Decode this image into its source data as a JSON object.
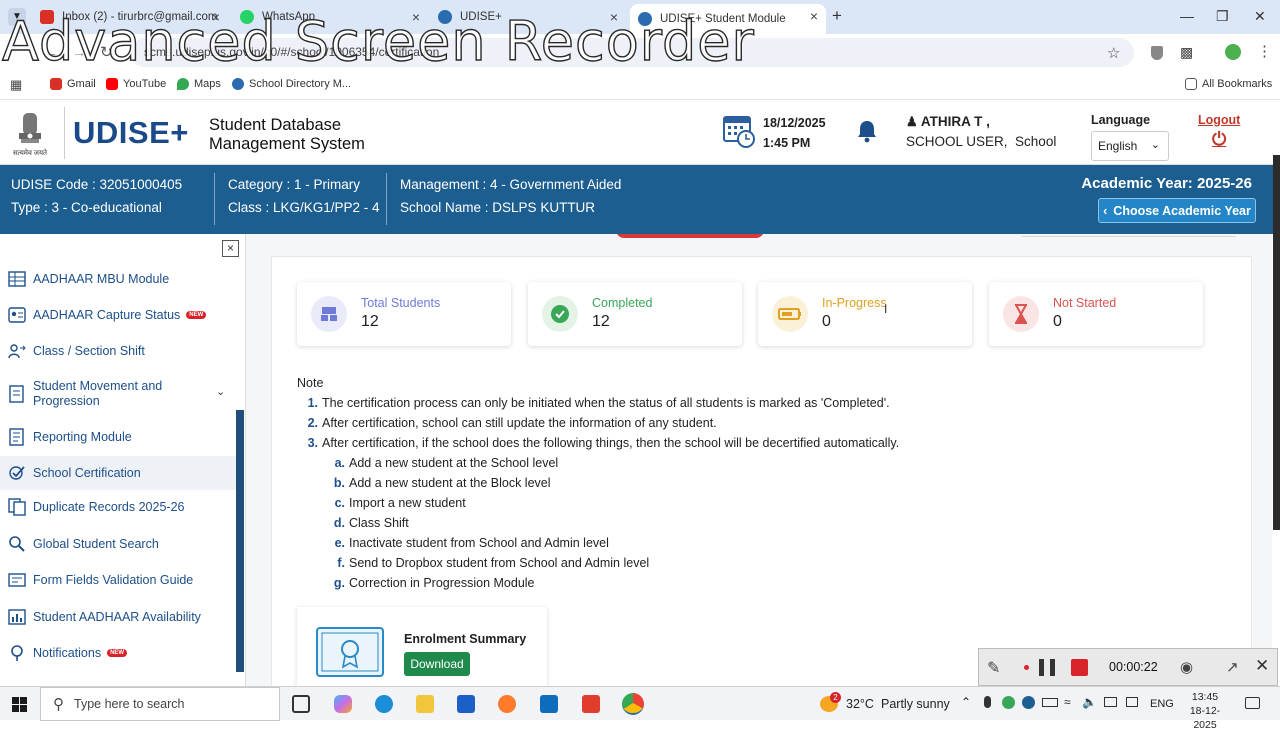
{
  "browser": {
    "tabs": [
      {
        "title": "Inbox (2) - tirurbrc@gmail.com",
        "color": "#d93025"
      },
      {
        "title": "WhatsApp",
        "color": "#25d366"
      },
      {
        "title": "UDISE+",
        "color": "#2b6cb0"
      },
      {
        "title": "UDISE+ Student Module",
        "color": "#2b6cb0"
      }
    ],
    "url": "scms.udiseplus.gov.in/g0/#/school/1006354/certification",
    "bookmarks": [
      "Gmail",
      "YouTube",
      "Maps",
      "School Directory M..."
    ],
    "all_bookmarks": "All Bookmarks",
    "watermark": "Advanced Screen Recorder"
  },
  "header": {
    "logo": "UDISE+",
    "app_name_line1": "Student Database",
    "app_name_line2": "Management System",
    "emblem_motto": "सत्यमेव जयते",
    "date": "18/12/2025",
    "time": "1:45 PM",
    "user_name": "ATHIRA T ,",
    "user_role": "SCHOOL USER,",
    "user_level": "School",
    "language_label": "Language",
    "language_value": "English",
    "logout": "Logout"
  },
  "school": {
    "udise_code": "UDISE Code : 32051000405",
    "type": "Type : 3 - Co-educational",
    "category": "Category : 1 - Primary",
    "class": "Class : LKG/KG1/PP2 - 4",
    "management": "Management : 4 - Government Aided",
    "school_name": "School Name : DSLPS KUTTUR",
    "academic_year": "Academic Year: 2025-26",
    "choose_year": "Choose Academic Year"
  },
  "sidebar": {
    "items": [
      {
        "label": "AADHAAR MBU Module",
        "icon": "grid-icon"
      },
      {
        "label": "AADHAAR Capture Status",
        "icon": "id-card-icon",
        "badge": "NEW"
      },
      {
        "label": "Class / Section Shift",
        "icon": "shift-icon"
      },
      {
        "label": "Student Movement and Progression",
        "icon": "document-icon"
      },
      {
        "label": "Reporting Module",
        "icon": "report-icon"
      },
      {
        "label": "School Certification",
        "icon": "check-icon",
        "active": true
      },
      {
        "label": "Duplicate Records 2025-26",
        "icon": "duplicate-icon"
      },
      {
        "label": "Global Student Search",
        "icon": "search-person-icon"
      },
      {
        "label": "Form Fields Validation Guide",
        "icon": "form-icon"
      },
      {
        "label": "Student AADHAAR Availability",
        "icon": "chart-icon"
      },
      {
        "label": "Notifications",
        "icon": "bell-pin-icon",
        "badge": "NEW"
      }
    ]
  },
  "stats": [
    {
      "label": "Total Students",
      "value": "12",
      "color": "#6f7bd9"
    },
    {
      "label": "Completed",
      "value": "12",
      "color": "#3aa657"
    },
    {
      "label": "In-Progress",
      "value": "0",
      "color": "#e0a020"
    },
    {
      "label": "Not Started",
      "value": "0",
      "color": "#d9534f"
    }
  ],
  "note": {
    "title": "Note",
    "items": [
      {
        "marker": "1.",
        "text": "The certification process can only be initiated when the status of all students is marked as 'Completed'."
      },
      {
        "marker": "2.",
        "text": "After certification, school can still update the information of any student."
      },
      {
        "marker": "3.",
        "text": "After certification, if the school does the following things, then the school will be decertified automatically."
      }
    ],
    "subitems": [
      {
        "marker": "a.",
        "text": "Add a new student at the School level"
      },
      {
        "marker": "b.",
        "text": "Add a new student at the Block level"
      },
      {
        "marker": "c.",
        "text": "Import a new student"
      },
      {
        "marker": "d.",
        "text": "Class Shift"
      },
      {
        "marker": "e.",
        "text": "Inactivate student from School and Admin level"
      },
      {
        "marker": "f.",
        "text": "Send to Dropbox student from School and Admin level"
      },
      {
        "marker": "g.",
        "text": "Correction in Progression Module"
      }
    ]
  },
  "enrolment": {
    "title": "Enrolment Summary",
    "button": "Download"
  },
  "recorder": {
    "timer": "00:00:22"
  },
  "taskbar": {
    "search_placeholder": "Type here to search",
    "weather_temp": "32°C",
    "weather_text": "Partly sunny",
    "weather_badge": "2",
    "lang": "ENG",
    "clock_time": "13:45",
    "clock_date": "18-12-2025"
  }
}
